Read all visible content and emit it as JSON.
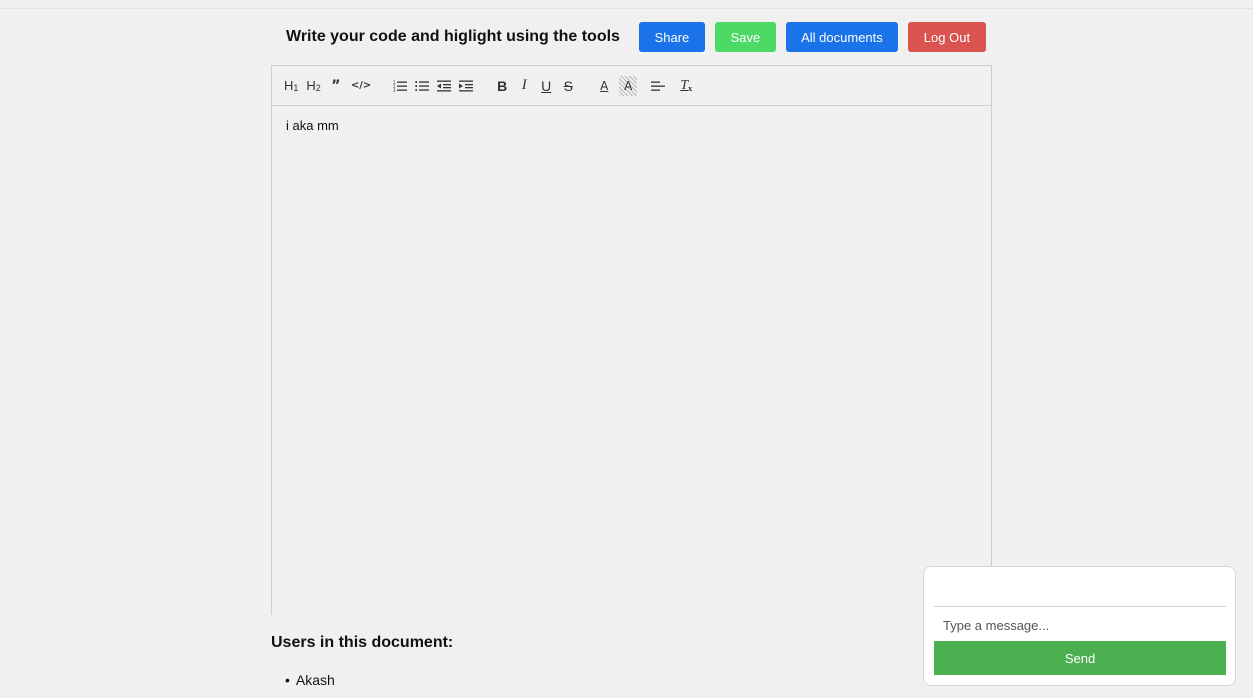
{
  "header": {
    "title": "Write your code and higlight using the tools",
    "share_label": "Share",
    "save_label": "Save",
    "all_documents_label": "All documents",
    "logout_label": "Log Out"
  },
  "toolbar": {
    "h1": "H",
    "h1_sub": "1",
    "h2": "H",
    "h2_sub": "2",
    "blockquote": "”",
    "code": "</>",
    "ordered_list": "☰",
    "bullet_list": "≡",
    "outdent": "⇤",
    "indent": "⇥",
    "bold": "B",
    "italic": "I",
    "underline": "U",
    "strike": "S",
    "color": "A",
    "background": "A",
    "align": "≡",
    "clean": "Tx"
  },
  "editor": {
    "content": "i aka mm"
  },
  "users": {
    "title": "Users in this document:",
    "list": [
      "Akash"
    ]
  },
  "chat": {
    "placeholder": "Type a message...",
    "send_label": "Send"
  },
  "colors": {
    "primary": "#1a73e8",
    "save": "#4cd964",
    "logout": "#d9534f",
    "send": "#4caf50",
    "background": "#f0f0f0"
  }
}
